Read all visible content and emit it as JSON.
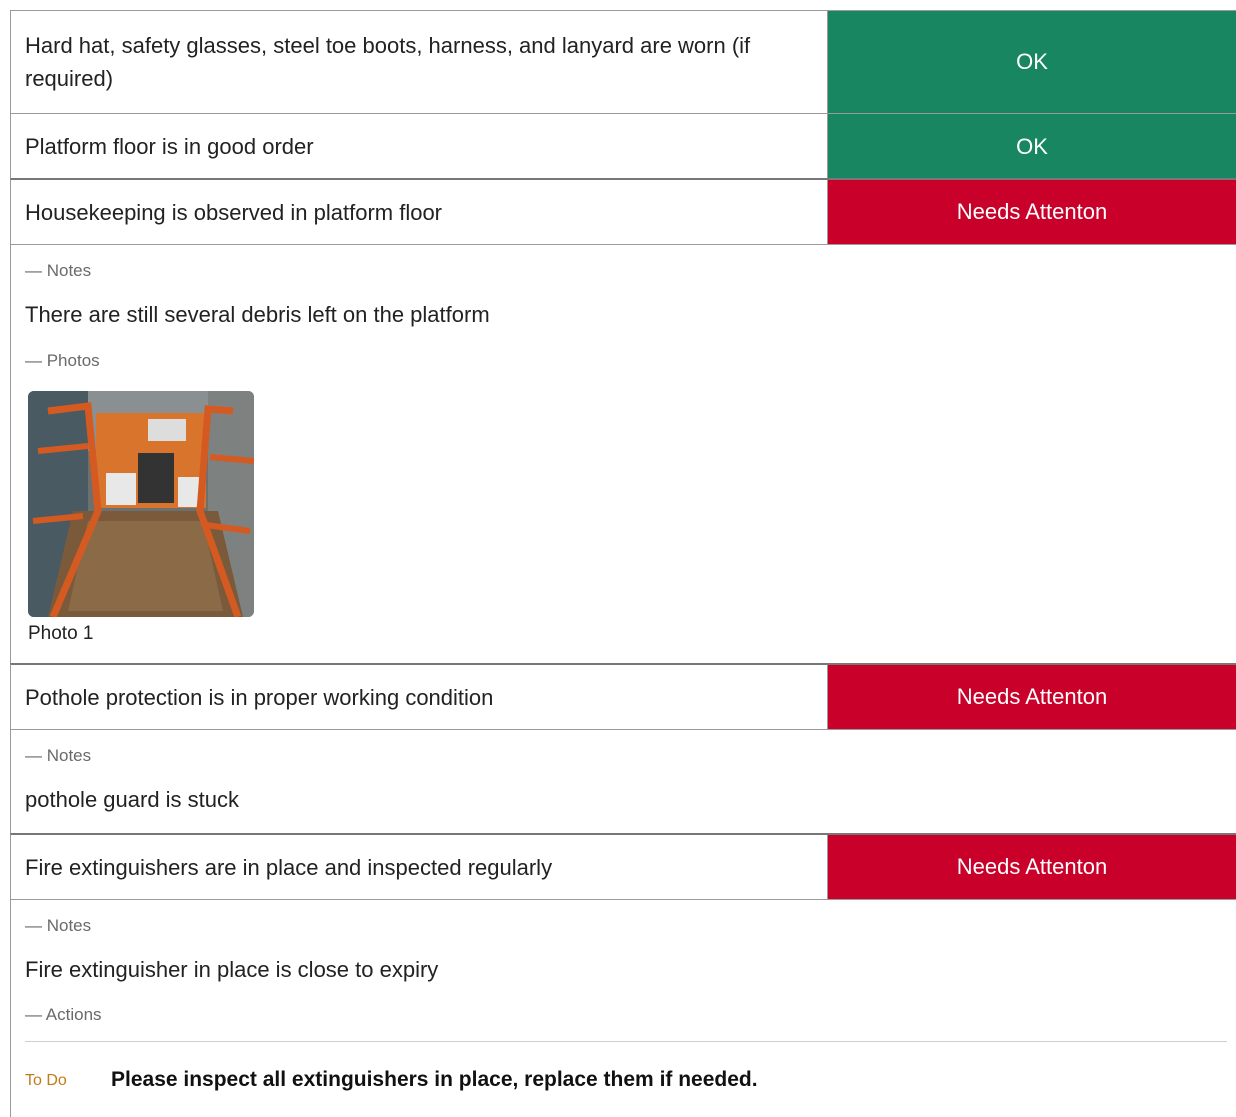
{
  "items": [
    {
      "question": "Hard hat, safety glasses, steel toe boots, harness, and lanyard are worn (if required)",
      "status": "OK"
    },
    {
      "question": "Platform floor is in good order",
      "status": "OK"
    },
    {
      "question": "Housekeeping is observed in platform floor",
      "status": "Needs Attenton",
      "notes_label": "— Notes",
      "notes": "There are still several debris left on the platform",
      "photos_label": "— Photos",
      "photo_caption": "Photo 1"
    },
    {
      "question": "Pothole protection is in proper working condition",
      "status": "Needs Attenton",
      "notes_label": "— Notes",
      "notes": "pothole guard is stuck"
    },
    {
      "question": "Fire extinguishers are in place and inspected regularly",
      "status": "Needs Attenton",
      "notes_label": "— Notes",
      "notes": "Fire extinguisher in place is close to expiry",
      "actions_label": "— Actions",
      "actions": [
        {
          "state": "To Do",
          "text": "Please inspect all extinguishers in place, replace them if needed."
        }
      ]
    }
  ],
  "colors": {
    "ok": "#178661",
    "needs_attention": "#c8002a",
    "todo": "#c07d17"
  }
}
